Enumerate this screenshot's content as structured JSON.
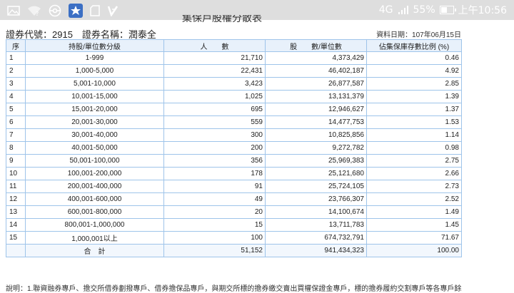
{
  "status_bar": {
    "network": "4G",
    "battery": "55%",
    "battery_level": 0.55,
    "time": "上午10:56",
    "icons": [
      "image-icon",
      "wifi-question-icon",
      "pokeball-icon",
      "app-icon",
      "sim-icon",
      "v-check-icon"
    ]
  },
  "page": {
    "title_partial": "集保戶股權分散表",
    "stock_code_label": "證券代號：2915　證券名稱：潤泰全",
    "data_date": "資料日期：107年06月15日"
  },
  "table": {
    "headers": [
      "序",
      "持股/單位數分級",
      "人　　數",
      "股　　數/單位數",
      "佔集保庫存數比例 (%)"
    ],
    "rows": [
      [
        "1",
        "1-999",
        "21,710",
        "4,373,429",
        "0.46"
      ],
      [
        "2",
        "1,000-5,000",
        "22,431",
        "46,402,187",
        "4.92"
      ],
      [
        "3",
        "5,001-10,000",
        "3,423",
        "26,877,587",
        "2.85"
      ],
      [
        "4",
        "10,001-15,000",
        "1,025",
        "13,131,379",
        "1.39"
      ],
      [
        "5",
        "15,001-20,000",
        "695",
        "12,946,627",
        "1.37"
      ],
      [
        "6",
        "20,001-30,000",
        "559",
        "14,477,753",
        "1.53"
      ],
      [
        "7",
        "30,001-40,000",
        "300",
        "10,825,856",
        "1.14"
      ],
      [
        "8",
        "40,001-50,000",
        "200",
        "9,272,782",
        "0.98"
      ],
      [
        "9",
        "50,001-100,000",
        "356",
        "25,969,383",
        "2.75"
      ],
      [
        "10",
        "100,001-200,000",
        "178",
        "25,121,680",
        "2.66"
      ],
      [
        "11",
        "200,001-400,000",
        "91",
        "25,724,105",
        "2.73"
      ],
      [
        "12",
        "400,001-600,000",
        "49",
        "23,766,307",
        "2.52"
      ],
      [
        "13",
        "600,001-800,000",
        "20",
        "14,100,674",
        "1.49"
      ],
      [
        "14",
        "800,001-1,000,000",
        "15",
        "13,711,783",
        "1.45"
      ],
      [
        "15",
        "1,000,001以上",
        "100",
        "674,732,791",
        "71.67"
      ]
    ],
    "total": {
      "label": "合　計",
      "people": "51,152",
      "shares": "941,434,323",
      "percent": "100.00"
    }
  },
  "footnote": "說明：1.聯資融券專戶、擔交所借券劃撥專戶、借券擔保品專戶，與期交所標的擔券繳交賣出買權保證金專戶，標的擔券履約交割專戶等各專戶餘"
}
